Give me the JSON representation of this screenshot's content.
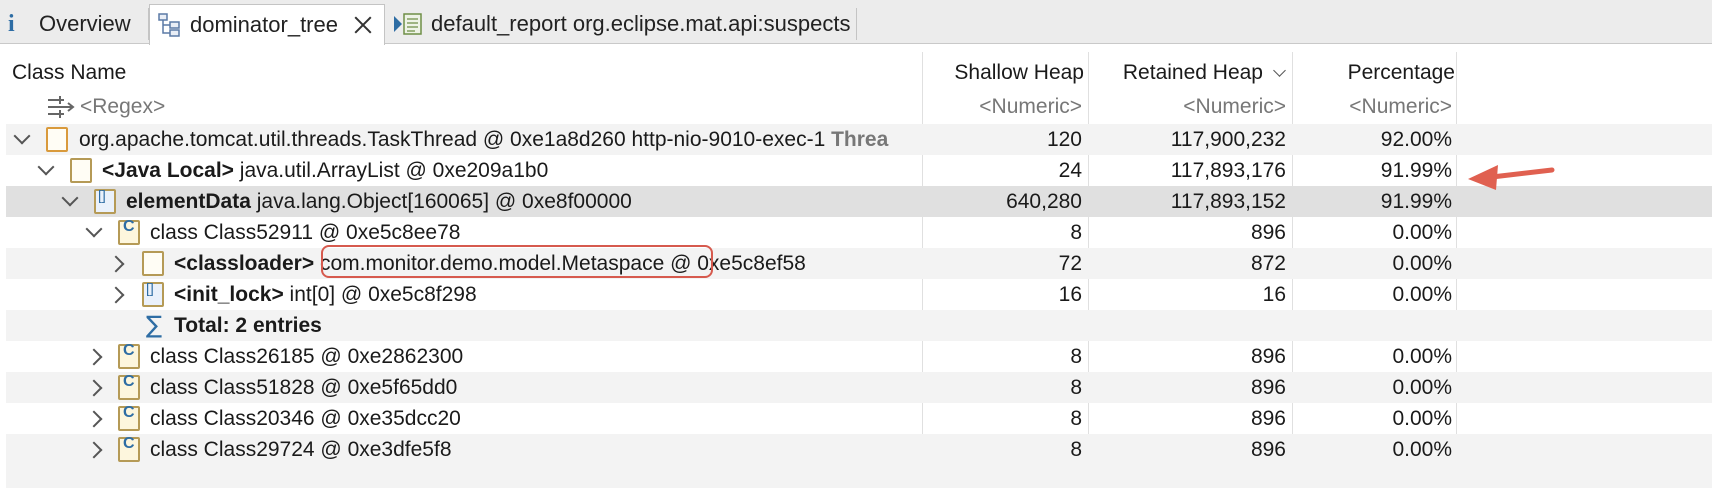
{
  "tabs": [
    {
      "label": "Overview",
      "icon": "info-icon",
      "active": false
    },
    {
      "label": "dominator_tree",
      "icon": "tree-icon",
      "active": true
    },
    {
      "label": "default_report org.eclipse.mat.api:suspects",
      "icon": "report-icon",
      "active": false
    }
  ],
  "columns": {
    "class_name": "Class Name",
    "shallow_heap": "Shallow Heap",
    "retained_heap": "Retained Heap",
    "percentage": "Percentage"
  },
  "filter_row": {
    "name": "<Regex>",
    "shallow": "<Numeric>",
    "retained": "<Numeric>",
    "percentage": "<Numeric>"
  },
  "rows": [
    {
      "prefix": "",
      "bold": "",
      "text": "org.apache.tomcat.util.threads.TaskThread @ 0xe1a8d260  http-nio-9010-exec-1 ",
      "tail": "Threa",
      "shallow": "120",
      "retained": "117,900,232",
      "percentage": "92.00%"
    },
    {
      "prefix": "",
      "bold": "<Java Local>",
      "text": " java.util.ArrayList @ 0xe209a1b0",
      "tail": "",
      "shallow": "24",
      "retained": "117,893,176",
      "percentage": "91.99%"
    },
    {
      "prefix": "",
      "bold": "elementData",
      "text": " java.lang.Object[160065] @ 0xe8f00000",
      "tail": "",
      "shallow": "640,280",
      "retained": "117,893,152",
      "percentage": "91.99%"
    },
    {
      "prefix": "",
      "bold": "",
      "text": "class Class52911 @ 0xe5c8ee78",
      "tail": "",
      "shallow": "8",
      "retained": "896",
      "percentage": "0.00%"
    },
    {
      "prefix": "",
      "bold": "<classloader>",
      "text": " com.monitor.demo.model.Metaspace @ 0xe5c8ef58",
      "tail": "",
      "shallow": "72",
      "retained": "872",
      "percentage": "0.00%"
    },
    {
      "prefix": "",
      "bold": "<init_lock>",
      "text": " int[0] @ 0xe5c8f298",
      "tail": "",
      "shallow": "16",
      "retained": "16",
      "percentage": "0.00%"
    },
    {
      "prefix": "",
      "bold": "Total: 2 entries",
      "text": "",
      "tail": "",
      "shallow": "",
      "retained": "",
      "percentage": ""
    },
    {
      "prefix": "",
      "bold": "",
      "text": "class Class26185 @ 0xe2862300",
      "tail": "",
      "shallow": "8",
      "retained": "896",
      "percentage": "0.00%"
    },
    {
      "prefix": "",
      "bold": "",
      "text": "class Class51828 @ 0xe5f65dd0",
      "tail": "",
      "shallow": "8",
      "retained": "896",
      "percentage": "0.00%"
    },
    {
      "prefix": "",
      "bold": "",
      "text": "class Class20346 @ 0xe35dcc20",
      "tail": "",
      "shallow": "8",
      "retained": "896",
      "percentage": "0.00%"
    },
    {
      "prefix": "",
      "bold": "",
      "text": "class Class29724 @ 0xe3dfe5f8",
      "tail": "",
      "shallow": "8",
      "retained": "896",
      "percentage": "0.00%"
    }
  ],
  "colors": {
    "accent_red": "#d65a4e",
    "selection": "#e0e0e0"
  }
}
